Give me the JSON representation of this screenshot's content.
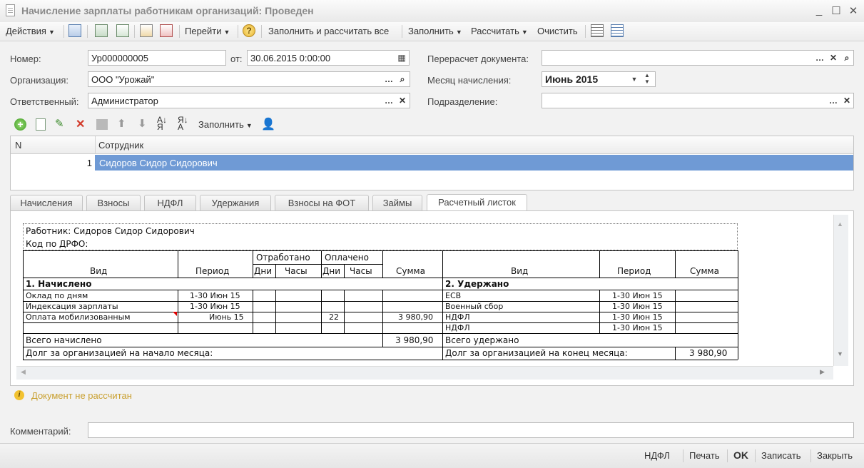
{
  "window": {
    "title": "Начисление зарплаты работникам организаций: Проведен",
    "minimize": "_",
    "maximize": "☐",
    "close": "✕"
  },
  "toolbar": {
    "actions": "Действия",
    "goto": "Перейти",
    "help": "?",
    "fill_calc": "Заполнить и рассчитать все",
    "fill": "Заполнить",
    "calculate": "Рассчитать",
    "clear": "Очистить"
  },
  "form": {
    "number_label": "Номер:",
    "number_value": "Ур000000005",
    "from_label": "от:",
    "date_value": "30.06.2015  0:00:00",
    "org_label": "Организация:",
    "org_value": "ООО \"Урожай\"",
    "resp_label": "Ответственный:",
    "resp_value": "Администратор",
    "recalc_label": "Перерасчет документа:",
    "recalc_value": "",
    "month_label": "Месяц начисления:",
    "month_value": "Июнь 2015",
    "dept_label": "Подразделение:",
    "dept_value": ""
  },
  "grid_toolbar": {
    "fill": "Заполнить"
  },
  "grid": {
    "columns": [
      "N",
      "Сотрудник"
    ],
    "rows": [
      {
        "n": "1",
        "employee": "Сидоров Сидор Сидорович"
      }
    ]
  },
  "tabs": [
    "Начисления",
    "Взносы",
    "НДФЛ",
    "Удержания",
    "Взносы на ФОТ",
    "Займы",
    "Расчетный листок"
  ],
  "active_tab": "Расчетный листок",
  "sheet": {
    "worker": "Работник: Сидоров Сидор Сидорович",
    "drfo": "Код по ДРФО:",
    "h_vid": "Вид",
    "h_period": "Период",
    "h_worked": "Отработано",
    "h_paid": "Оплачено",
    "h_days": "Дни",
    "h_hours": "Часы",
    "h_sum": "Сумма",
    "accrued_title": "1. Начислено",
    "deducted_title": "2. Удержано",
    "accruals": [
      {
        "vid": "Оклад по дням",
        "period": "1-30 Июн 15",
        "paid_days": "",
        "sum": ""
      },
      {
        "vid": "Индексация зарплаты",
        "period": "1-30 Июн 15",
        "paid_days": "",
        "sum": ""
      },
      {
        "vid": "Оплата мобилизованным",
        "period": "Июнь 15",
        "paid_days": "22",
        "sum": "3 980,90"
      }
    ],
    "deductions": [
      {
        "vid": "ЕСВ",
        "period": "1-30 Июн 15"
      },
      {
        "vid": "Военный сбор",
        "period": "1-30 Июн 15"
      },
      {
        "vid": "НДФЛ",
        "period": "1-30 Июн 15"
      },
      {
        "vid": "НДФЛ",
        "period": "1-30 Июн 15"
      }
    ],
    "total_accrued_label": "Всего начислено",
    "total_accrued": "3 980,90",
    "total_deducted_label": "Всего удержано",
    "debt_start_label": "Долг за организацией на начало месяца:",
    "debt_end_label": "Долг за организацией на конец месяца:",
    "debt_end": "3 980,90"
  },
  "notice": "Документ не рассчитан",
  "comment_label": "Комментарий:",
  "comment_value": "",
  "bottom": {
    "ndfl": "НДФЛ",
    "print": "Печать",
    "ok": "OK",
    "save": "Записать",
    "close": "Закрыть"
  }
}
